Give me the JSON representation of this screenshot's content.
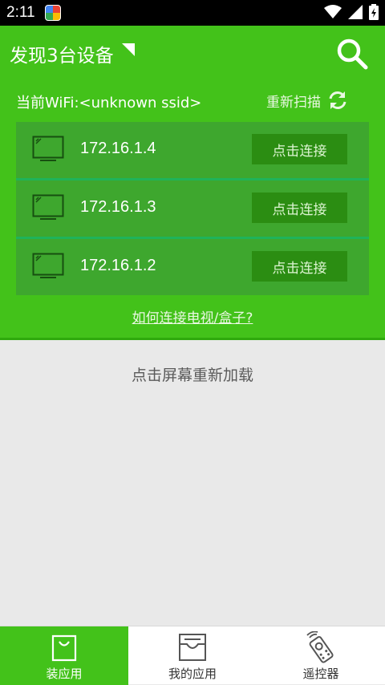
{
  "status_bar": {
    "time": "2:11"
  },
  "header": {
    "title": "发现3台设备",
    "wifi": "当前WiFi:<unknown ssid>",
    "rescan": "重新扫描",
    "howto": "如何连接电视/盒子?"
  },
  "devices": [
    {
      "ip": "172.16.1.4",
      "action": "点击连接"
    },
    {
      "ip": "172.16.1.3",
      "action": "点击连接"
    },
    {
      "ip": "172.16.1.2",
      "action": "点击连接"
    }
  ],
  "content": {
    "reload": "点击屏幕重新加载"
  },
  "bottom_nav": {
    "tabs": [
      {
        "label": "装应用",
        "icon": "shopping-bag-icon",
        "active": true
      },
      {
        "label": "我的应用",
        "icon": "inbox-tray-icon",
        "active": false
      },
      {
        "label": "遥控器",
        "icon": "remote-control-icon",
        "active": false
      }
    ]
  },
  "colors": {
    "brand_green": "#43c21a",
    "device_bg": "#3ea72e",
    "button": "#2b8d12",
    "separator": "#1fb35a"
  }
}
